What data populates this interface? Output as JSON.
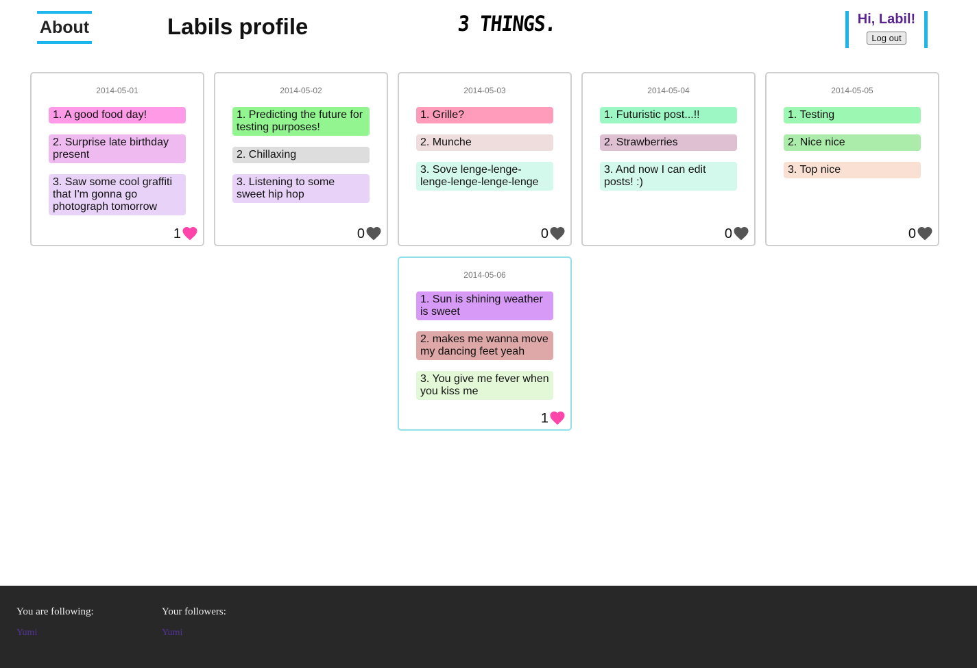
{
  "nav": {
    "about_label": "About"
  },
  "page_title": "Labils profile",
  "logo_text": "3 THINGS.",
  "user": {
    "greeting": "Hi, Labil!",
    "logout_label": "Log out"
  },
  "colors": {
    "accent": "#1cb6ec",
    "greeting": "#5a2590",
    "heart_liked": "#ff44aa",
    "heart_unliked": "#555555",
    "footer_bg": "#282828"
  },
  "posts": [
    {
      "date": "2014-05-01",
      "things": [
        {
          "text": "1. A good food day!",
          "color": "#ff9be6"
        },
        {
          "text": "2. Surprise late birthday present",
          "color": "#eebaf0"
        },
        {
          "text": "3. Saw some cool graffiti that I'm gonna go photograph tomorrow",
          "color": "#e8d2f8"
        }
      ],
      "likes": "1",
      "liked": true
    },
    {
      "date": "2014-05-02",
      "things": [
        {
          "text": "1. Predicting the future for testing purposes!",
          "color": "#92f590"
        },
        {
          "text": "2. Chillaxing",
          "color": "#dddddd"
        },
        {
          "text": "3. Listening to some sweet hip hop",
          "color": "#e8d2f8"
        }
      ],
      "likes": "0",
      "liked": false
    },
    {
      "date": "2014-05-03",
      "things": [
        {
          "text": "1. Grille?",
          "color": "#ff9bbb"
        },
        {
          "text": "2. Munche",
          "color": "#efdcdc"
        },
        {
          "text": "3. Sove lenge-lenge-lenge-lenge-lenge-lenge",
          "color": "#d3f8ec"
        }
      ],
      "likes": "0",
      "liked": false
    },
    {
      "date": "2014-05-04",
      "things": [
        {
          "text": "1. Futuristic post...!!",
          "color": "#9cf7c5"
        },
        {
          "text": "2. Strawberries",
          "color": "#dfbfd2"
        },
        {
          "text": "3. And now I can edit posts! :)",
          "color": "#d3f8ec"
        }
      ],
      "likes": "0",
      "liked": false
    },
    {
      "date": "2014-05-05",
      "things": [
        {
          "text": "1. Testing",
          "color": "#9cf7b2"
        },
        {
          "text": "2. Nice nice",
          "color": "#acecaa"
        },
        {
          "text": "3. Top nice",
          "color": "#f9e0d3"
        }
      ],
      "likes": "0",
      "liked": false
    },
    {
      "date": "2014-05-06",
      "things": [
        {
          "text": "1. Sun is shining weather is sweet",
          "color": "#d79af6"
        },
        {
          "text": "2. makes me wanna move my dancing feet yeah",
          "color": "#dfa8a8"
        },
        {
          "text": "3. You give me fever when you kiss me",
          "color": "#e3f8d6"
        }
      ],
      "likes": "1",
      "liked": true
    }
  ],
  "footer": {
    "following_label": "You are following:",
    "following": [
      "Yumi"
    ],
    "followers_label": "Your followers:",
    "followers": [
      "Yumi"
    ]
  }
}
